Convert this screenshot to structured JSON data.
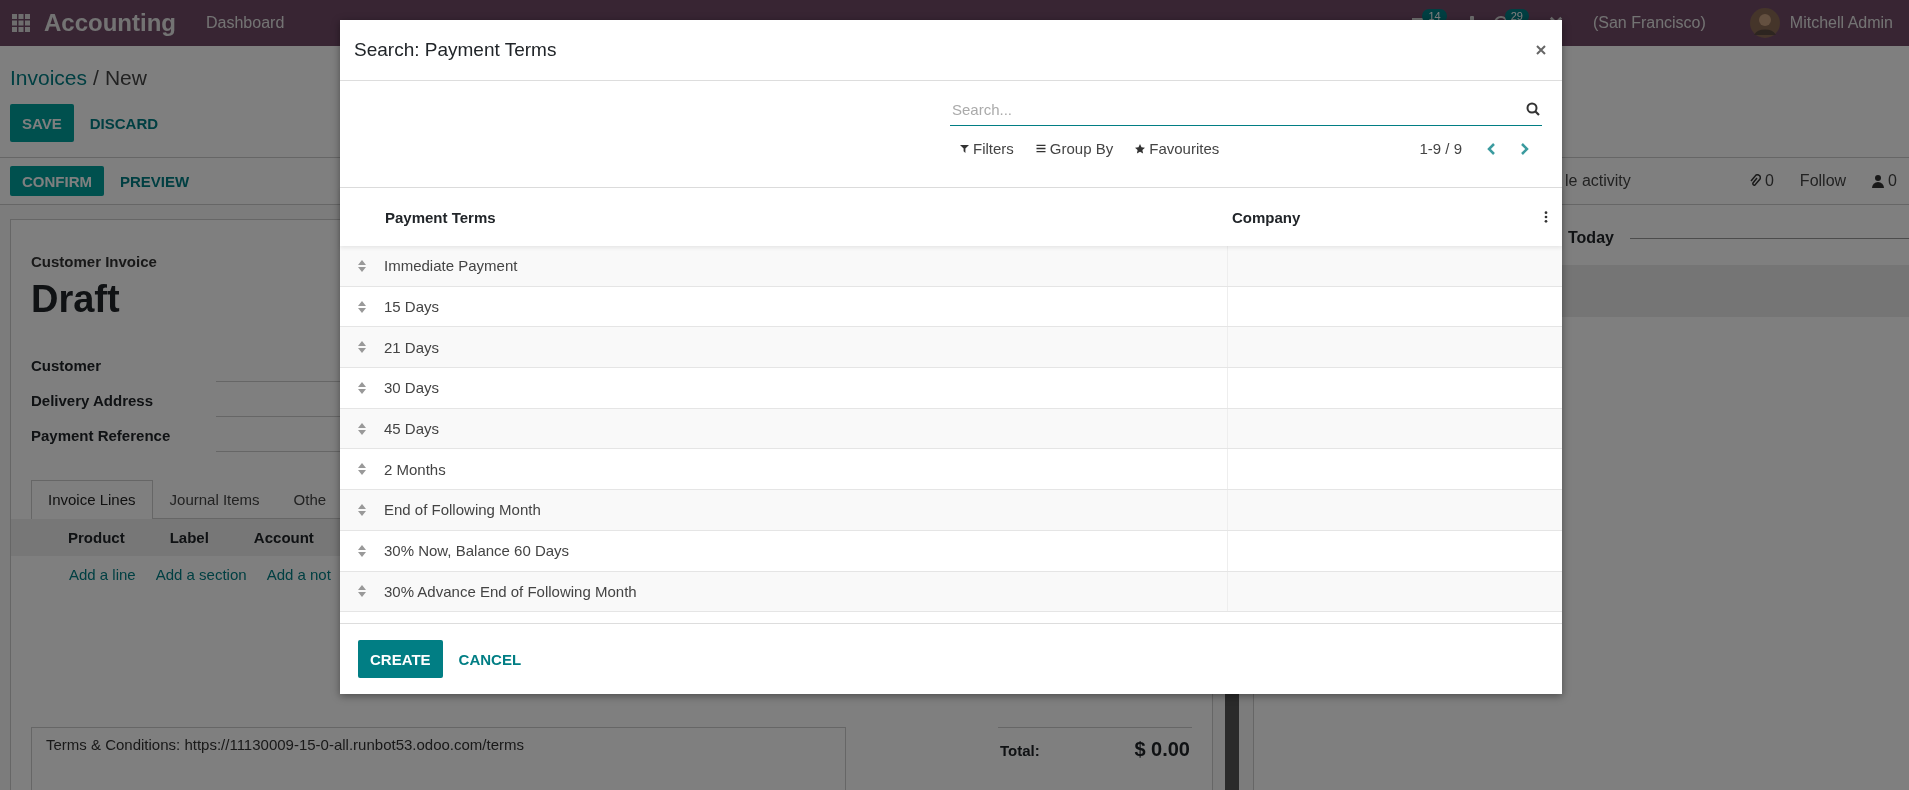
{
  "topbar": {
    "app_name": "Accounting",
    "menu": [
      "Dashboard"
    ],
    "messages_badge": "14",
    "activities_badge": "29",
    "company": "(San Francisco)",
    "user": "Mitchell Admin"
  },
  "breadcrumb": {
    "parent": "Invoices",
    "separator": "/",
    "current": "New"
  },
  "form_buttons": [
    "SAVE",
    "DISCARD"
  ],
  "status_buttons": [
    "CONFIRM",
    "PREVIEW"
  ],
  "chatter": {
    "activity_link": "le activity",
    "attachments": "0",
    "follow": "Follow",
    "followers": "0",
    "day": "Today"
  },
  "sheet": {
    "type_label": "Customer Invoice",
    "state": "Draft",
    "fields": [
      "Customer",
      "Delivery Address",
      "Payment Reference"
    ],
    "tabs": [
      {
        "label": "Invoice Lines",
        "selected": true
      },
      {
        "label": "Journal Items",
        "selected": false
      },
      {
        "label": "Othe",
        "selected": false
      }
    ],
    "columns": [
      "Product",
      "Label",
      "Account"
    ],
    "add_links": [
      "Add a line",
      "Add a section",
      "Add a not"
    ],
    "terms": "Terms & Conditions: https://11130009-15-0-all.runbot53.odoo.com/terms",
    "total_label": "Total:",
    "total": "$ 0.00"
  },
  "dialog": {
    "title": "Search: Payment Terms",
    "search": {
      "placeholder": "Search..."
    },
    "filters": [
      "Filters",
      "Group By",
      "Favourites"
    ],
    "pager": "1-9 / 9",
    "columns": [
      "Payment Terms",
      "Company"
    ],
    "rows": [
      {
        "name": "Immediate Payment"
      },
      {
        "name": "15 Days"
      },
      {
        "name": "21 Days"
      },
      {
        "name": "30 Days"
      },
      {
        "name": "45 Days"
      },
      {
        "name": "2 Months"
      },
      {
        "name": "End of Following Month"
      },
      {
        "name": "30% Now, Balance 60 Days"
      },
      {
        "name": "30% Advance End of Following Month"
      }
    ],
    "buttons": [
      "CREATE",
      "CANCEL"
    ]
  }
}
